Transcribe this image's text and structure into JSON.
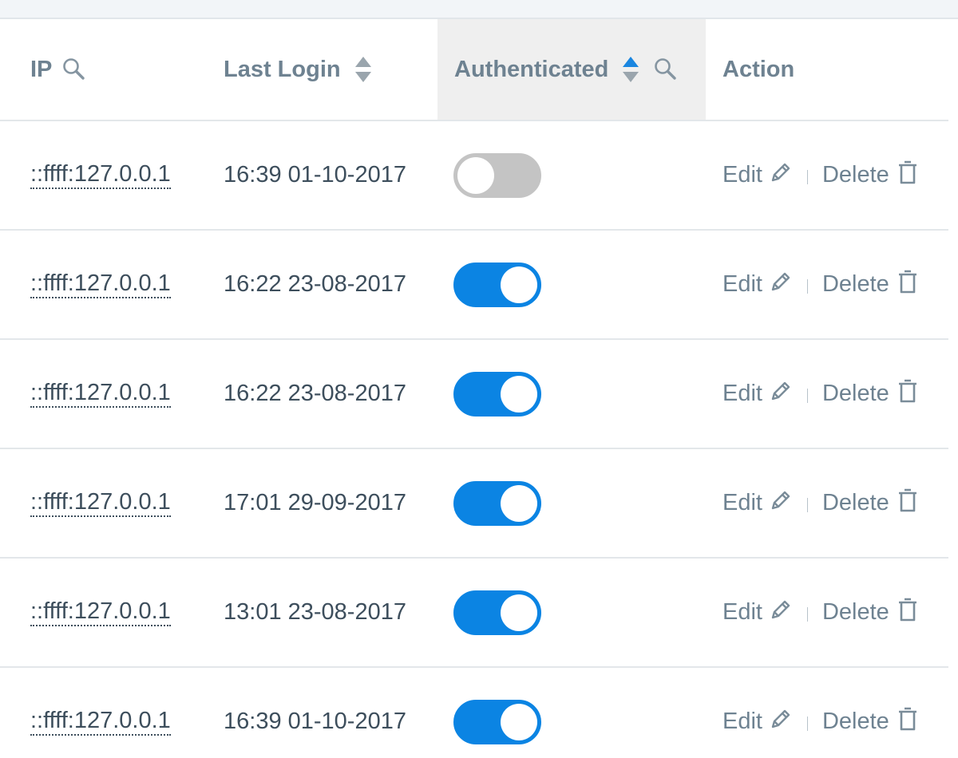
{
  "colors": {
    "header_text": "#6e8291",
    "body_text": "#3d4e5c",
    "toggle_on": "#0b84e3",
    "toggle_off": "#c4c4c4",
    "sorted_column_bg": "#efefef"
  },
  "columns": {
    "ip": "IP",
    "last_login": "Last Login",
    "authenticated": "Authenticated",
    "action": "Action"
  },
  "header_icons": {
    "ip": [
      "search-icon"
    ],
    "last_login": [
      "sort-icon"
    ],
    "authenticated": [
      "sort-ascending-icon",
      "search-icon"
    ]
  },
  "actions": {
    "edit_label": "Edit",
    "delete_label": "Delete",
    "edit_icon": "pencil-icon",
    "delete_icon": "trash-icon"
  },
  "rows": [
    {
      "ip": "::ffff:127.0.0.1",
      "last_login": "16:39 01-10-2017",
      "authenticated": false
    },
    {
      "ip": "::ffff:127.0.0.1",
      "last_login": "16:22 23-08-2017",
      "authenticated": true
    },
    {
      "ip": "::ffff:127.0.0.1",
      "last_login": "16:22 23-08-2017",
      "authenticated": true
    },
    {
      "ip": "::ffff:127.0.0.1",
      "last_login": "17:01 29-09-2017",
      "authenticated": true
    },
    {
      "ip": "::ffff:127.0.0.1",
      "last_login": "13:01 23-08-2017",
      "authenticated": true
    },
    {
      "ip": "::ffff:127.0.0.1",
      "last_login": "16:39 01-10-2017",
      "authenticated": true
    }
  ]
}
